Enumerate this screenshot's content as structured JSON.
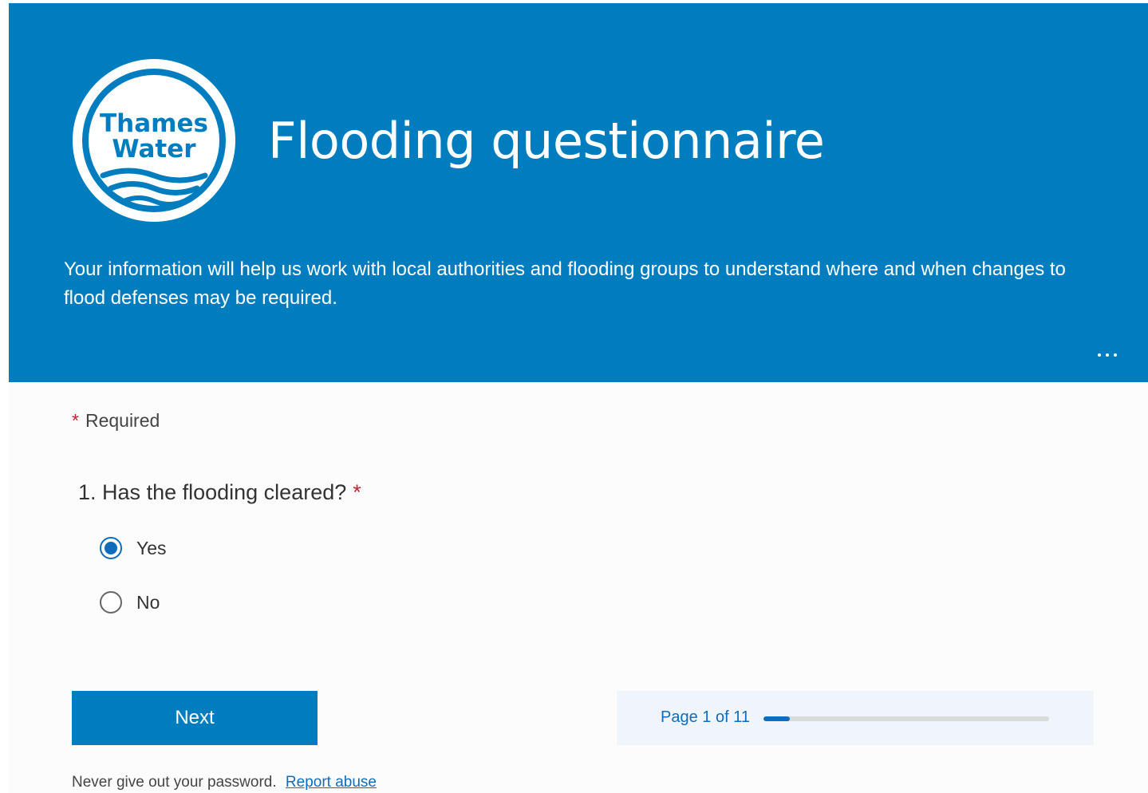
{
  "header": {
    "logo": {
      "line1": "Thames",
      "line2": "Water"
    },
    "title": "Flooding questionnaire",
    "description": "Your information will help us work with local authorities and flooding groups to understand where and when changes to flood defenses may be required.",
    "more_icon": "ellipsis-icon",
    "brand_color": "#007dbf"
  },
  "form": {
    "required_marker": "*",
    "required_text": "Required",
    "question": {
      "number": "1.",
      "text": "Has the flooding cleared?",
      "required_marker": "*",
      "options": [
        {
          "label": "Yes",
          "selected": true
        },
        {
          "label": "No",
          "selected": false
        }
      ]
    },
    "next_label": "Next",
    "progress": {
      "text": "Page 1 of 11",
      "current": 1,
      "total": 11
    }
  },
  "footer": {
    "notice": "Never give out your password.",
    "link": "Report abuse"
  }
}
